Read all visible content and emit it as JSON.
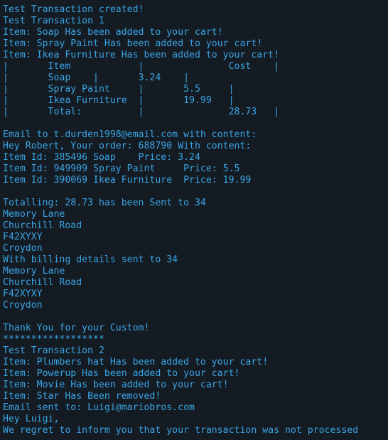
{
  "terminal": {
    "text_color": "#3aa5e6",
    "background_color": "#141b22",
    "lines": [
      "Test Transaction created!",
      "Test Transaction 1",
      "Item: Soap Has been added to your cart!",
      "Item: Spray Paint Has been added to your cart!",
      "Item: Ikea Furniture Has been added to your cart!",
      "|       Item            |               Cost    |",
      "|       Soap    |       3.24    |",
      "|       Spray Paint     |       5.5     |",
      "|       Ikea Furniture  |       19.99   |",
      "|       Total:          |               28.73   |",
      "",
      "Email to t.durden1998@email.com with content:",
      "Hey Robert, Your order: 688790 With content:",
      "Item Id: 385496 Soap    Price: 3.24",
      "Item Id: 949909 Spray Paint     Price: 5.5",
      "Item Id: 390069 Ikea Furniture  Price: 19.99",
      "",
      "Totalling: 28.73 has been Sent to 34",
      "Memory Lane",
      "Churchill Road",
      "F42XYXY",
      "Croydon",
      "With billing details sent to 34",
      "Memory Lane",
      "Churchill Road",
      "F42XYXY",
      "Croydon",
      "",
      "Thank You for your Custom!",
      "******************",
      "Test Transaction 2",
      "Item: Plumbers hat Has been added to your cart!",
      "Item: Powerup Has been added to your cart!",
      "Item: Movie Has been added to your cart!",
      "Item: Star Has Been removed!",
      "Email sent to: Luigi@mariobros.com",
      "Hey Luigi,",
      "We regret to inform you that your transaction was not processed"
    ]
  }
}
